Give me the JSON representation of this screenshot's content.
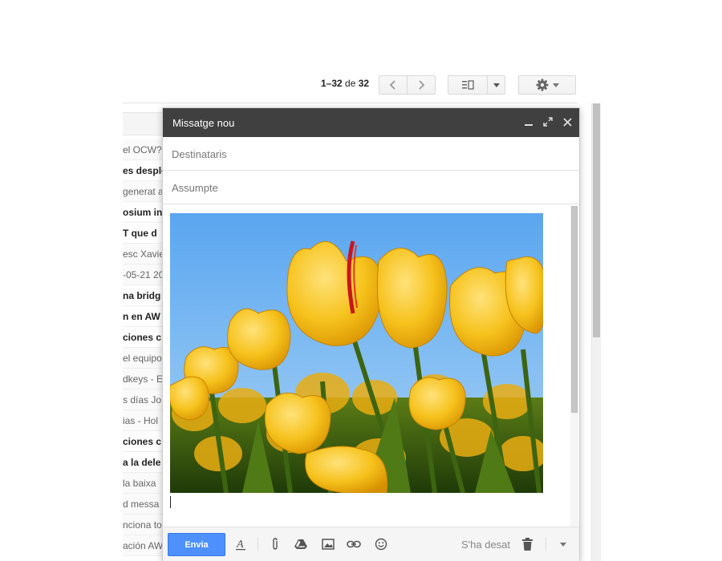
{
  "toolbar": {
    "pager_range": "1–32",
    "pager_of": "de",
    "pager_total": "32"
  },
  "email_list": {
    "rows": [
      {
        "text": "el OCW?",
        "unread": false
      },
      {
        "text": "es desple",
        "unread": true
      },
      {
        "text": "generat a",
        "unread": false
      },
      {
        "text": "osium in",
        "unread": true
      },
      {
        "text": "T que d",
        "unread": true
      },
      {
        "text": "esc Xavie",
        "unread": false
      },
      {
        "text": "-05-21 20",
        "unread": false
      },
      {
        "text": "na bridg",
        "unread": true
      },
      {
        "text": "n en AW",
        "unread": true
      },
      {
        "text": "ciones c",
        "unread": true
      },
      {
        "text": "el equipo",
        "unread": false
      },
      {
        "text": "dkeys - E",
        "unread": false
      },
      {
        "text": "s días Jo",
        "unread": false
      },
      {
        "text": "ias - Hol",
        "unread": false
      },
      {
        "text": "ciones c",
        "unread": true
      },
      {
        "text": "a la dele",
        "unread": true
      },
      {
        "text": "la baixa",
        "unread": false
      },
      {
        "text": "d messa",
        "unread": false
      },
      {
        "text": "nciona to",
        "unread": false
      },
      {
        "text": "ación AW",
        "unread": false
      }
    ]
  },
  "compose": {
    "title": "Missatge nou",
    "to_placeholder": "Destinataris",
    "subject_placeholder": "Assumpte",
    "send_label": "Envia",
    "saved_status": "S'ha desat"
  },
  "colors": {
    "title_bar": "#404040",
    "send_button": "#4d90fe",
    "sky": "#6fb6f2",
    "tulip": "#f5c01f"
  }
}
